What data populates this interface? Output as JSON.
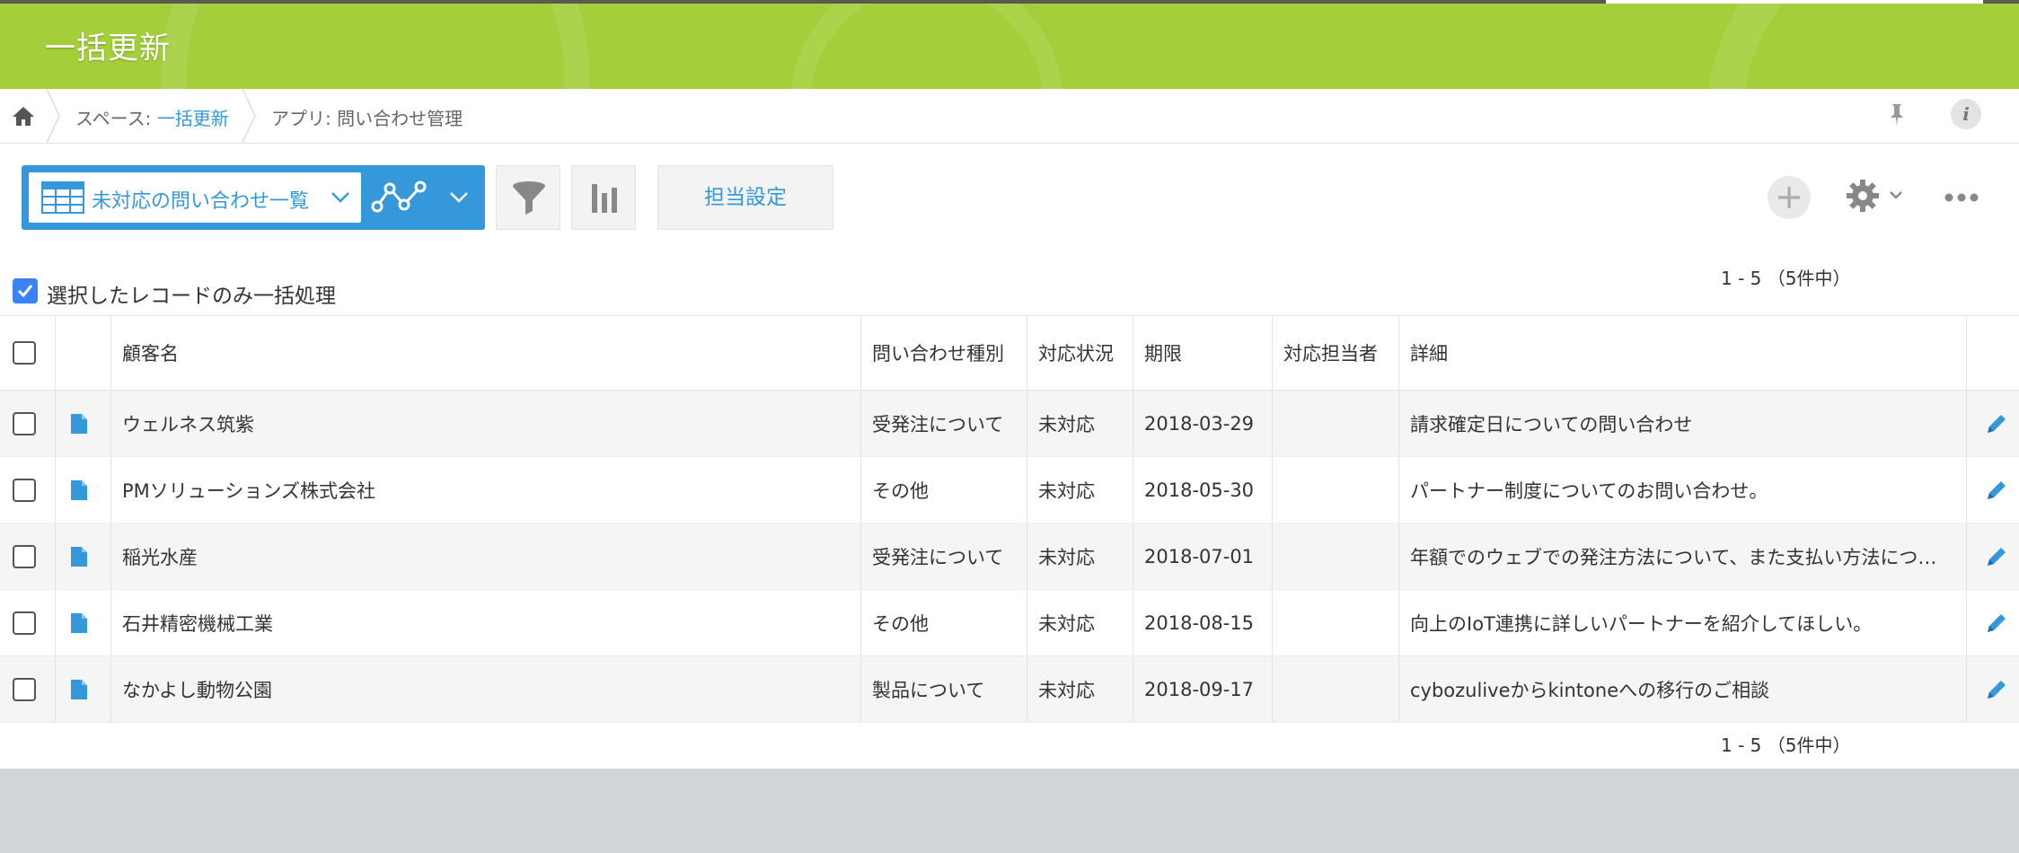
{
  "header": {
    "title": "一括更新"
  },
  "breadcrumb": {
    "space_prefix": "スペース: ",
    "space_name": "一括更新",
    "app_label": "アプリ: 問い合わせ管理"
  },
  "toolbar": {
    "view_name": "未対応の問い合わせ一覧",
    "assign_button": "担当設定",
    "add_symbol": "+"
  },
  "pagination": {
    "text": "1 - 5 （5件中）"
  },
  "bulk": {
    "label": "選択したレコードのみ一括処理",
    "checked": true
  },
  "table": {
    "columns": {
      "name": "顧客名",
      "type": "問い合わせ種別",
      "status": "対応状況",
      "due": "期限",
      "owner": "対応担当者",
      "detail": "詳細"
    },
    "rows": [
      {
        "name": "ウェルネス筑紫",
        "type": "受発注について",
        "status": "未対応",
        "due": "2018-03-29",
        "owner": "",
        "detail": "請求確定日についての問い合わせ"
      },
      {
        "name": "PMソリューションズ株式会社",
        "type": "その他",
        "status": "未対応",
        "due": "2018-05-30",
        "owner": "",
        "detail": "パートナー制度についてのお問い合わせ。"
      },
      {
        "name": "稲光水産",
        "type": "受発注について",
        "status": "未対応",
        "due": "2018-07-01",
        "owner": "",
        "detail": "年額でのウェブでの発注方法について、また支払い方法につ…"
      },
      {
        "name": "石井精密機械工業",
        "type": "その他",
        "status": "未対応",
        "due": "2018-08-15",
        "owner": "",
        "detail": "向上のIoT連携に詳しいパートナーを紹介してほしい。"
      },
      {
        "name": "なかよし動物公園",
        "type": "製品について",
        "status": "未対応",
        "due": "2018-09-17",
        "owner": "",
        "detail": "cybozuliveからkintoneへの移行のご相談"
      }
    ]
  },
  "colors": {
    "accent": "#3498db",
    "banner": "#a4cf3a"
  }
}
